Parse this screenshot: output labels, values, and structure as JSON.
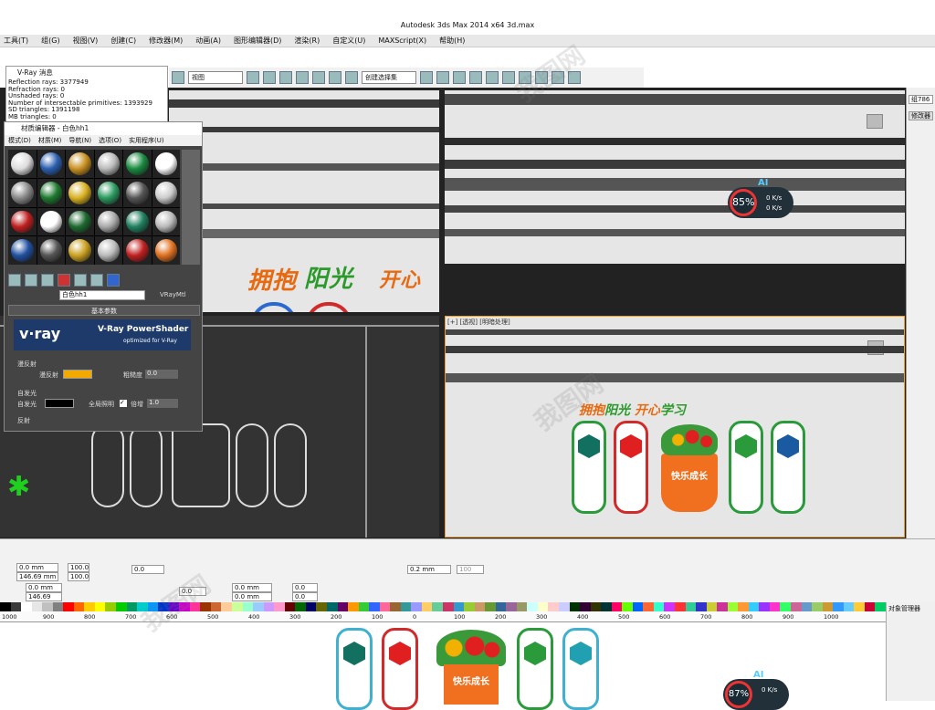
{
  "window": {
    "title": "Autodesk 3ds Max  2014 x64        3d.max"
  },
  "menu": [
    "工具(T)",
    "组(G)",
    "视图(V)",
    "创建(C)",
    "修改器(M)",
    "动画(A)",
    "图形编辑器(D)",
    "渲染(R)",
    "自定义(U)",
    "MAXScript(X)",
    "帮助(H)"
  ],
  "toolbar": {
    "view_select": "视图",
    "named_sel": "创建选择集"
  },
  "vray_log": {
    "title": "V-Ray 消息",
    "lines": [
      "Reflection rays: 3377949",
      "Refraction rays: 0",
      "Unshaded rays: 0",
      "Number of intersectable primitives: 1393929",
      "SD triangles: 1391198",
      "MB triangles: 0"
    ]
  },
  "material_editor": {
    "title": "材质编辑器 - 白色hh1",
    "menu": [
      "模式(D)",
      "材质(M)",
      "导航(N)",
      "选项(O)",
      "实用程序(U)"
    ],
    "material_name": "白色hh1",
    "material_type": "VRayMtl",
    "rollout": "基本参数",
    "vray_brand": "v·ray",
    "vray_product": "V-Ray PowerShader",
    "vray_tag": "optimized for V-Ray",
    "diffuse_section": "漫反射",
    "diffuse_label": "漫反射",
    "roughness_label": "粗糙度",
    "roughness_value": "0.0",
    "selfillum_section": "自发光",
    "selfillum_label": "自发光",
    "gi_label": "全局照明",
    "multiplier_label": "倍增",
    "multiplier_value": "1.0",
    "reflect_section": "反射",
    "diffuse_color": "#f2a900",
    "spheres": [
      "#ddd",
      "#2b5fb0",
      "#c89020",
      "#bbb",
      "#1a8a40",
      "#fff",
      "#888",
      "#1f7a30",
      "#d8b020",
      "#2a9a60",
      "#555",
      "#ccc",
      "#c02020",
      "#fff",
      "#1e6a30",
      "#aaa",
      "#1f8060",
      "#bbb",
      "#2050a0",
      "#555",
      "#caa020",
      "#bbb",
      "#c02020",
      "#e07020"
    ]
  },
  "viewport": {
    "slogan_a": "拥抱",
    "slogan_b": "阳光",
    "slogan_c": "开心",
    "slogan_d": "学习",
    "label_br": "[+] [透视] [明暗处理]",
    "hud_pct": "85%",
    "hud_up": "0 K/s",
    "hud_down": "0 K/s",
    "hud_ai": "AI",
    "vase_text": "快乐成长"
  },
  "right_panel": {
    "field": "组786",
    "label": "修改器列"
  },
  "bottom": {
    "x": "0.0 mm",
    "y": "146.69 mm",
    "sx": "100.0",
    "sy": "100.0",
    "pct": "%",
    "angle": "0.0",
    "line_w": "0.2 mm",
    "zoom": "100",
    "x2": "0.0 mm",
    "y2": "146.69 mm",
    "angle2": "0.0",
    "pos_a": "0.0 mm",
    "pos_b": "0.0 mm",
    "val_a": "0.0",
    "val_b": "0.0"
  },
  "object_manager": {
    "title": "对象管理器"
  },
  "ruler_marks": [
    "1000",
    "900",
    "800",
    "700",
    "600",
    "500",
    "400",
    "300",
    "200",
    "100",
    "0",
    "100",
    "200",
    "300",
    "400",
    "500",
    "600",
    "700",
    "800",
    "900",
    "1000"
  ],
  "palette": [
    "#000",
    "#3a3a3a",
    "#fff",
    "#e6e6e6",
    "#c0c0c0",
    "#808080",
    "#ff0000",
    "#ff6600",
    "#ffcc00",
    "#ffff00",
    "#99cc00",
    "#00cc00",
    "#009966",
    "#00cccc",
    "#0099ff",
    "#0033cc",
    "#6600cc",
    "#cc00cc",
    "#ff3399",
    "#993300",
    "#cc6633",
    "#ffcc99",
    "#ccff99",
    "#99ffcc",
    "#99ccff",
    "#cc99ff",
    "#ff99cc",
    "#660000",
    "#006600",
    "#000066",
    "#666600",
    "#006666",
    "#660066",
    "#ff9900",
    "#33cc33",
    "#3366ff",
    "#ff6699",
    "#996633",
    "#339999",
    "#9999ff",
    "#ffcc66",
    "#66cc99",
    "#cc3366",
    "#3399cc",
    "#99cc33",
    "#cc9966",
    "#669933",
    "#336699",
    "#996699",
    "#999966",
    "#ccffff",
    "#ffffcc",
    "#ffcccc",
    "#ccccff",
    "#003300",
    "#330033",
    "#333300",
    "#003333",
    "#ff0066",
    "#66ff00",
    "#0066ff",
    "#ff6633",
    "#33ffcc",
    "#cc33ff",
    "#ff3333",
    "#33cc99",
    "#3333cc",
    "#cccc33",
    "#cc3399",
    "#99ff33",
    "#ff9933",
    "#33ccff",
    "#9933ff",
    "#ff33cc",
    "#33ff66",
    "#cc6699",
    "#6699cc",
    "#99cc66",
    "#cc9933",
    "#3399ff",
    "#66ccff",
    "#ffcc33",
    "#cc0033",
    "#00cc66"
  ]
}
